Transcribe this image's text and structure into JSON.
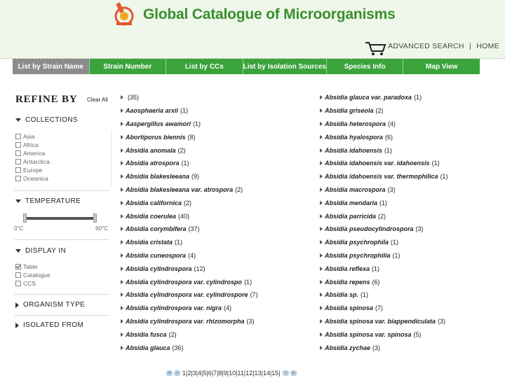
{
  "header": {
    "title": "Global Catalogue of Microorganisms",
    "logo_icon": "gcm-logo-icon",
    "cart_icon": "shopping-cart-icon",
    "links": [
      "ADVANCED SEARCH",
      "HOME"
    ],
    "accent_color": "#3aa33a"
  },
  "nav": {
    "tabs": [
      {
        "label": "List by Strain Name",
        "active": true
      },
      {
        "label": "Strain Number"
      },
      {
        "label": "List by CCs"
      },
      {
        "label": "List by Isolation Sources"
      },
      {
        "label": "Species Info"
      },
      {
        "label": "Map View"
      }
    ]
  },
  "sidebar": {
    "title": "REFINE BY",
    "clear_all": "Clear All",
    "collections": {
      "label": "COLLECTIONS",
      "options": [
        "Asia",
        "Africa",
        "America",
        "Antarctica",
        "Europe",
        "Oceanica"
      ]
    },
    "temperature": {
      "label": "TEMPERATURE",
      "min_label": "0°C",
      "max_label": "90°C"
    },
    "display_in": {
      "label": "DISPLAY IN",
      "options": [
        {
          "label": "Table",
          "checked": true
        },
        {
          "label": "Catalogue",
          "checked": false
        },
        {
          "label": "CCS",
          "checked": false
        }
      ]
    },
    "organism_type": {
      "label": "ORGANISM TYPE"
    },
    "isolated_from": {
      "label": "ISOLATED FROM"
    }
  },
  "list": {
    "left": [
      {
        "name": "",
        "count": "(35)"
      },
      {
        "name": "Aaosphaeria arxii",
        "count": "(1)"
      },
      {
        "name": "Aaspergillus awamori",
        "count": "(1)"
      },
      {
        "name": "Abortiporus biennis",
        "count": "(8)"
      },
      {
        "name": "Absidia anomala",
        "count": "(2)"
      },
      {
        "name": "Absidia atrospora",
        "count": "(1)"
      },
      {
        "name": "Absidia blakesleeana",
        "count": "(9)"
      },
      {
        "name": "Absidia blakesleeana var. atrospora",
        "count": "(2)"
      },
      {
        "name": "Absidia californica",
        "count": "(2)"
      },
      {
        "name": "Absidia coerulea",
        "count": "(40)"
      },
      {
        "name": "Absidia corymbifera",
        "count": "(37)"
      },
      {
        "name": "Absidia cristata",
        "count": "(1)"
      },
      {
        "name": "Absidia cuneospora",
        "count": "(4)"
      },
      {
        "name": "Absidia cylindrospora",
        "count": "(12)"
      },
      {
        "name": "Absidia cylindrospora var. cylindrospo",
        "count": "(1)"
      },
      {
        "name": "Absidia cylindrospora var. cylindrospore",
        "count": "(7)"
      },
      {
        "name": "Absidia cylindrospora var. nigra",
        "count": "(4)"
      },
      {
        "name": "Absidia cylindrospora var. rhizomorpha",
        "count": "(3)"
      },
      {
        "name": "Absidia fusca",
        "count": "(2)"
      },
      {
        "name": "Absidia glauca",
        "count": "(36)"
      }
    ],
    "right": [
      {
        "name": "Absidia glauca var. paradoxa",
        "count": "(1)"
      },
      {
        "name": "Absidia griseola",
        "count": "(2)"
      },
      {
        "name": "Absidia heterospora",
        "count": "(4)"
      },
      {
        "name": "Absidia hyalospora",
        "count": "(6)"
      },
      {
        "name": "Absidia idahoensis",
        "count": "(1)"
      },
      {
        "name": "Absidia idahoensis var. idahoensis",
        "count": "(1)"
      },
      {
        "name": "Absidia idahoensis var. thermophilica",
        "count": "(1)"
      },
      {
        "name": "Absidia macrospora",
        "count": "(3)"
      },
      {
        "name": "Absidia mendaria",
        "count": "(1)"
      },
      {
        "name": "Absidia parricida",
        "count": "(2)"
      },
      {
        "name": "Absidia pseudocylindrospora",
        "count": "(3)"
      },
      {
        "name": "Absidia psychrophila",
        "count": "(1)"
      },
      {
        "name": "Absidia psychrophilia",
        "count": "(1)"
      },
      {
        "name": "Absidia reflexa",
        "count": "(1)"
      },
      {
        "name": "Absidia repens",
        "count": "(6)"
      },
      {
        "name": "Absidia sp.",
        "count": "(1)"
      },
      {
        "name": "Absidia spinosa",
        "count": "(7)"
      },
      {
        "name": "Absidia spinosa var. biappendiculata",
        "count": "(3)"
      },
      {
        "name": "Absidia spinosa var. spinosa",
        "count": "(5)"
      },
      {
        "name": "Absidia zychae",
        "count": "(3)"
      }
    ]
  },
  "pagination": {
    "first": "«",
    "prev": "‹",
    "pages": "1|2|3|4|5|6|7|8|9|10|11|12|13|14|15|",
    "next": "›",
    "last": "»"
  }
}
